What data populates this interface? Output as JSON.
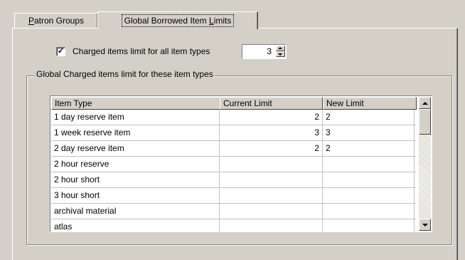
{
  "tabs": [
    {
      "label": "Patron Groups",
      "hotkey": "P",
      "rest": "atron Groups",
      "active": false
    },
    {
      "label": "Global Borrowed Item Limits",
      "before": "Global Borrowed Item ",
      "hotkey": "L",
      "after": "imits",
      "active": true
    }
  ],
  "charged_limit": {
    "label": "Charged items limit for all item types",
    "checked": true,
    "check_glyph": "✓",
    "value": "3"
  },
  "group": {
    "label": "Global Charged items limit for these item types"
  },
  "grid": {
    "columns": [
      "Item Type",
      "Current Limit",
      "New Limit"
    ],
    "rows": [
      {
        "item_type": "1 day reserve item",
        "current_limit": "2",
        "new_limit": "2"
      },
      {
        "item_type": "1 week reserve item",
        "current_limit": "3",
        "new_limit": "3"
      },
      {
        "item_type": "2 day reserve item",
        "current_limit": "2",
        "new_limit": "2"
      },
      {
        "item_type": "2 hour reserve",
        "current_limit": "",
        "new_limit": ""
      },
      {
        "item_type": "2 hour short",
        "current_limit": "",
        "new_limit": ""
      },
      {
        "item_type": "3 hour short",
        "current_limit": "",
        "new_limit": ""
      },
      {
        "item_type": "archival material",
        "current_limit": "",
        "new_limit": ""
      },
      {
        "item_type": "atlas",
        "current_limit": "",
        "new_limit": ""
      }
    ]
  },
  "icons": {
    "scroll_up": "scroll-up-arrow-icon",
    "scroll_down": "scroll-down-arrow-icon",
    "spin_up": "spin-up-arrow-icon",
    "spin_down": "spin-down-arrow-icon"
  }
}
